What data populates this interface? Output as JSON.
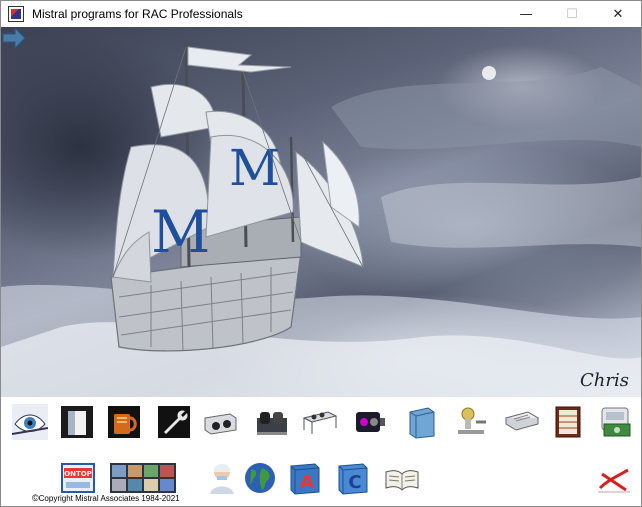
{
  "window": {
    "title": "Mistral programs for RAC Professionals",
    "controls": {
      "minimize": "—",
      "maximize": "☐",
      "close": "✕"
    }
  },
  "hero": {
    "logo_letter": "M",
    "sail_letter": "M",
    "signature": "Chris"
  },
  "toolbar_row1": [
    {
      "name": "eye-icon"
    },
    {
      "name": "door-frame-icon"
    },
    {
      "name": "tea-mug-icon"
    },
    {
      "name": "wrench-tool-icon"
    },
    {
      "name": "condensing-unit-icon"
    },
    {
      "name": "compressor-unit-icon"
    },
    {
      "name": "air-cooled-condenser-icon"
    },
    {
      "name": "evaporator-coil-icon"
    },
    {
      "name": "scroll-compressor-icon"
    },
    {
      "name": "air-handling-unit-icon"
    },
    {
      "name": "expansion-valve-icon"
    },
    {
      "name": "cassette-unit-icon"
    },
    {
      "name": "refrigerated-cabinet-icon"
    },
    {
      "name": "cost-calculator-icon"
    }
  ],
  "toolbar_row2": {
    "ontop_label": "ONTOP",
    "book_a_letter": "A",
    "book_c_letter": "C",
    "items": [
      {
        "name": "ontop-icon"
      },
      {
        "name": "photo-gallery-icon"
      },
      {
        "name": "nurse-icon"
      },
      {
        "name": "globe-icon"
      },
      {
        "name": "book-a-icon"
      },
      {
        "name": "book-c-icon"
      },
      {
        "name": "open-book-icon"
      },
      {
        "name": "exit-icon"
      }
    ]
  },
  "footer": {
    "copyright_symbol": "©",
    "copyright_text": "Copyright Mistral Associates 1984-2021"
  },
  "colors": {
    "sail": "#d9dde3",
    "sail_letter": "#1f4f9c",
    "hull": "#b8bcc2",
    "arrow": "#4a7aa6",
    "exit": "#d62020"
  }
}
